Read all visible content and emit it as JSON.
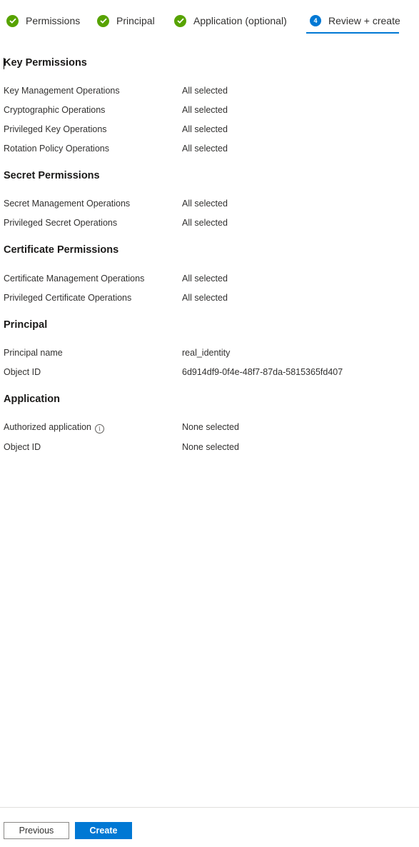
{
  "colors": {
    "accent": "#0078d4",
    "success": "#57a300",
    "text": "#323130"
  },
  "tabs": [
    {
      "label": "Permissions",
      "state": "completed",
      "icon": "check-circle-icon"
    },
    {
      "label": "Principal",
      "state": "completed",
      "icon": "check-circle-icon"
    },
    {
      "label": "Application (optional)",
      "state": "completed",
      "icon": "check-circle-icon"
    },
    {
      "label": "Review + create",
      "state": "active",
      "step_number": "4"
    }
  ],
  "sections": {
    "key_permissions": {
      "title": "Key Permissions",
      "rows": [
        {
          "label": "Key Management Operations",
          "value": "All selected"
        },
        {
          "label": "Cryptographic Operations",
          "value": "All selected"
        },
        {
          "label": "Privileged Key Operations",
          "value": "All selected"
        },
        {
          "label": "Rotation Policy Operations",
          "value": "All selected"
        }
      ]
    },
    "secret_permissions": {
      "title": "Secret Permissions",
      "rows": [
        {
          "label": "Secret Management Operations",
          "value": "All selected"
        },
        {
          "label": "Privileged Secret Operations",
          "value": "All selected"
        }
      ]
    },
    "certificate_permissions": {
      "title": "Certificate Permissions",
      "rows": [
        {
          "label": "Certificate Management Operations",
          "value": "All selected"
        },
        {
          "label": "Privileged Certificate Operations",
          "value": "All selected"
        }
      ]
    },
    "principal": {
      "title": "Principal",
      "rows": [
        {
          "label": "Principal name",
          "value": "real_identity"
        },
        {
          "label": "Object ID",
          "value": "6d914df9-0f4e-48f7-87da-5815365fd407"
        }
      ]
    },
    "application": {
      "title": "Application",
      "rows": [
        {
          "label": "Authorized application",
          "value": "None selected",
          "icon": "info-icon"
        },
        {
          "label": "Object ID",
          "value": "None selected"
        }
      ]
    }
  },
  "footer": {
    "previous_label": "Previous",
    "create_label": "Create"
  }
}
